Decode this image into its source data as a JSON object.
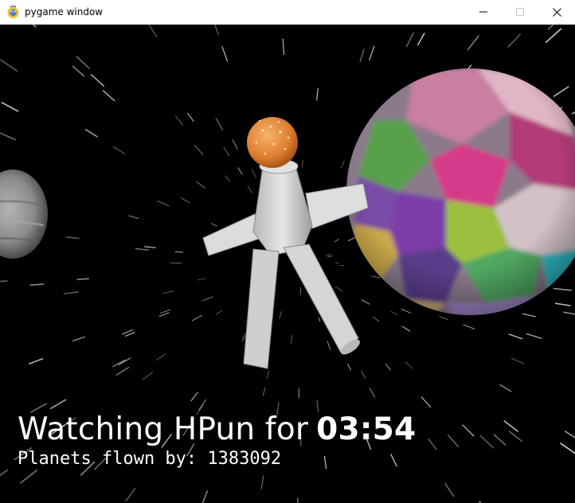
{
  "window": {
    "title": "pygame window",
    "icon": "pygame-snake-icon",
    "controls": [
      "minimize-icon",
      "maximize-icon",
      "close-icon"
    ]
  },
  "hud": {
    "watching_prefix": "Watching HPun for",
    "timer": "03:54",
    "planets_label": "Planets flown by:",
    "planets_count": "1383092"
  },
  "colors": {
    "background": "#000000",
    "text": "#ffffff",
    "head": "#e0873a",
    "body": "#d8d8d8"
  }
}
